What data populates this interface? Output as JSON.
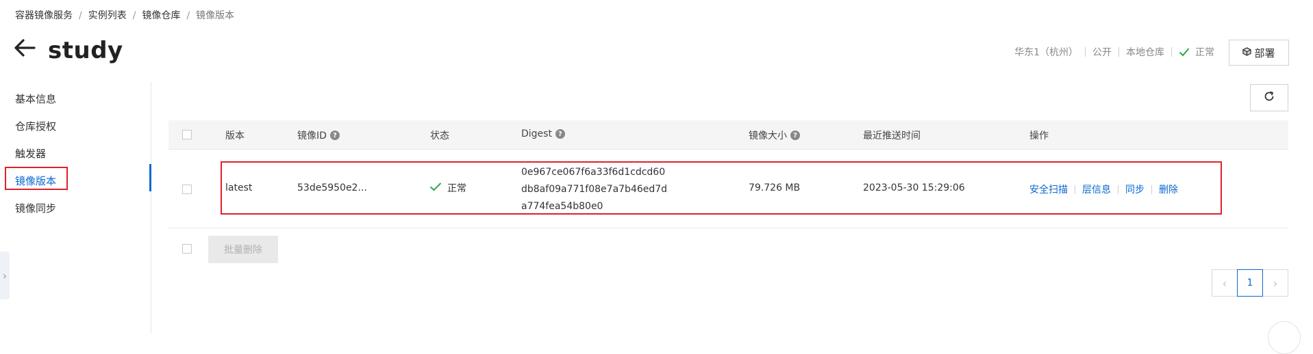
{
  "breadcrumb": {
    "items": [
      "容器镜像服务",
      "实例列表",
      "镜像仓库"
    ],
    "current": "镜像版本",
    "separator": "/"
  },
  "header": {
    "title": "study",
    "region": "华东1（杭州）",
    "visibility": "公开",
    "repo_type": "本地仓库",
    "status": "正常",
    "deploy_label": "部署",
    "deploy_icon": "cube-icon"
  },
  "sidebar": {
    "items": [
      {
        "label": "基本信息"
      },
      {
        "label": "仓库授权"
      },
      {
        "label": "触发器"
      },
      {
        "label": "镜像版本"
      },
      {
        "label": "镜像同步"
      }
    ],
    "active_index": 3
  },
  "table": {
    "columns": {
      "version": "版本",
      "image_id": "镜像ID",
      "status": "状态",
      "digest": "Digest",
      "size": "镜像大小",
      "pushed_at": "最近推送时间",
      "actions": "操作"
    },
    "rows": [
      {
        "version": "latest",
        "image_id": "53de5950e2...",
        "status": "正常",
        "digest_lines": [
          "0e967ce067f6a33f6d1cdcd60",
          "db8af09a771f08e7a7b46ed7d",
          "a774fea54b80e0"
        ],
        "size": "79.726 MB",
        "pushed_at": "2023-05-30 15:29:06",
        "actions": [
          "安全扫描",
          "层信息",
          "同步",
          "删除"
        ]
      }
    ],
    "batch_delete_label": "批量删除"
  },
  "pagination": {
    "current_page": "1"
  },
  "colors": {
    "accent": "#0a67d1",
    "success": "#28a745",
    "highlight": "#e0202a"
  }
}
